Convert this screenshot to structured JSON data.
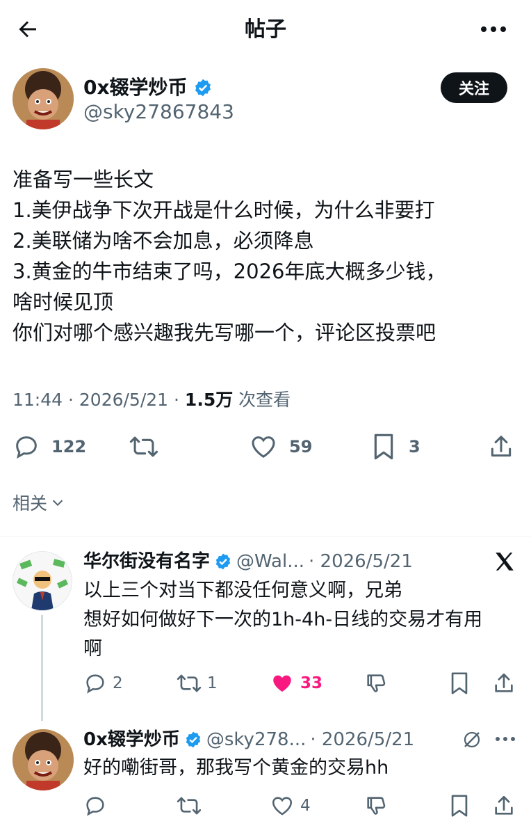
{
  "header": {
    "title": "帖子"
  },
  "post": {
    "author_name": "0x辍学炒币",
    "author_handle": "@sky27867843",
    "follow_label": "关注",
    "lines": [
      "准备写一些长文",
      "1.美伊战争下次开战是什么时候，为什么非要打",
      "2.美联储为啥不会加息，必须降息",
      "3.黄金的牛市结束了吗，2026年底大概多少钱，",
      "啥时候见顶",
      "你们对哪个感兴趣我先写哪一个，评论区投票吧"
    ],
    "time": "11:44 · 2026/5/21 ·",
    "views": "1.5万",
    "views_label": "次查看",
    "replies": "122",
    "likes": "59",
    "bookmarks": "3"
  },
  "related": {
    "label": "相关"
  },
  "reply1": {
    "author_name": "华尔街没有名字",
    "author_handle": "@Wal...",
    "date": "· 2026/5/21",
    "lines": [
      "以上三个对当下都没任何意义啊，兄弟",
      "想好如何做好下一次的1h-4h-日线的交易才有用",
      "啊"
    ],
    "replies": "2",
    "reposts": "1",
    "likes": "33",
    "like_color": "#f91880"
  },
  "reply2": {
    "author_name": "0x辍学炒币",
    "author_handle": "@sky278...",
    "date": "· 2026/5/21",
    "text": "好的嘞街哥，那我写个黄金的交易hh",
    "likes": "4"
  },
  "colors": {
    "verified": "#1d9bf0",
    "text": "#0f1419",
    "muted": "#536471"
  }
}
